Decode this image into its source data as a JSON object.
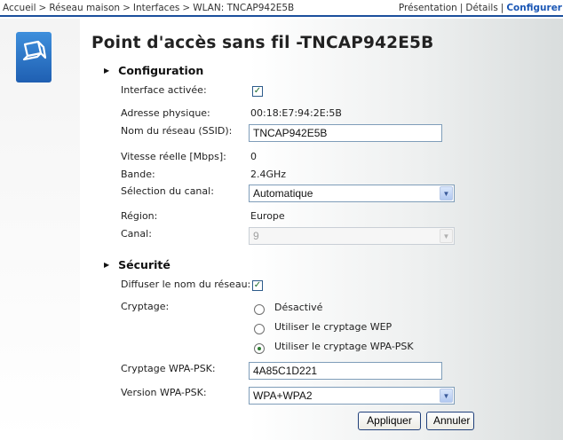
{
  "breadcrumb": {
    "items": [
      "Accueil",
      "Réseau maison",
      "Interfaces",
      "WLAN: TNCAP942E5B"
    ],
    "separator": ">"
  },
  "view_links": {
    "presentation": "Présentation",
    "details": "Détails",
    "configure": "Configurer",
    "divider": "|"
  },
  "icon": {
    "name": "wireless-device-icon",
    "color": "#2a6fc4"
  },
  "page": {
    "title": "Point d'accès sans fil -TNCAP942E5B"
  },
  "configuration": {
    "heading": "Configuration",
    "interface_label": "Interface activée:",
    "interface_checked": true,
    "mac_label": "Adresse physique:",
    "mac_value": "00:18:E7:94:2E:5B",
    "ssid_label": "Nom du réseau (SSID):",
    "ssid_value": "TNCAP942E5B",
    "speed_label": "Vitesse réelle [Mbps]:",
    "speed_value": "0",
    "band_label": "Bande:",
    "band_value": "2.4GHz",
    "channel_sel_label": "Sélection du canal:",
    "channel_sel_value": "Automatique",
    "region_label": "Région:",
    "region_value": "Europe",
    "channel_label": "Canal:",
    "channel_value": "9"
  },
  "security": {
    "heading": "Sécurité",
    "broadcast_label": "Diffuser le nom du réseau:",
    "broadcast_checked": true,
    "encryption_label": "Cryptage:",
    "options": [
      "Désactivé",
      "Utiliser le cryptage WEP",
      "Utiliser le cryptage WPA-PSK"
    ],
    "selected_option": "Utiliser le cryptage WPA-PSK",
    "wpa_key_label": "Cryptage WPA-PSK:",
    "wpa_key_value": "4A85C1D221",
    "wpa_version_label": "Version WPA-PSK:",
    "wpa_version_value": "WPA+WPA2"
  },
  "buttons": {
    "apply": "Appliquer",
    "cancel": "Annuler"
  },
  "colors": {
    "accent": "#1b4f9c",
    "link_active": "#1b57b5",
    "check": "#1c6a2a"
  }
}
